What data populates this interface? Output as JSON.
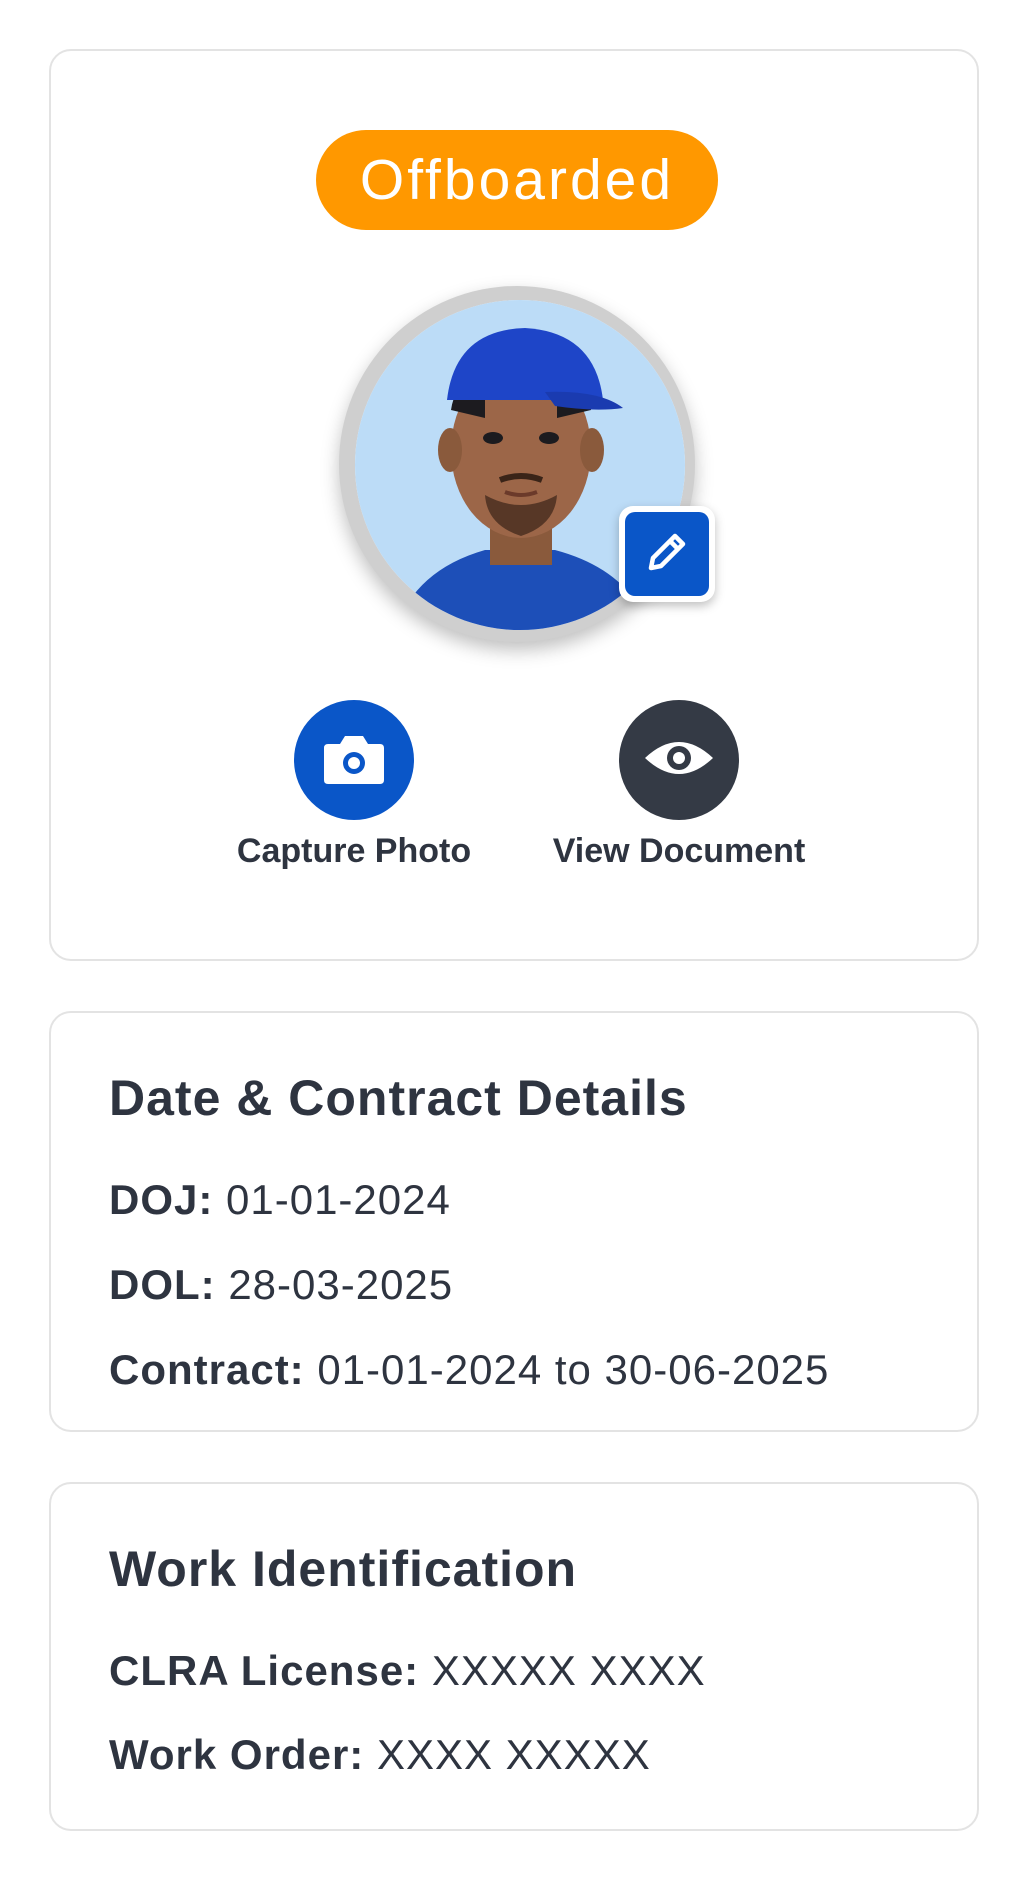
{
  "profile": {
    "status": "Offboarded",
    "status_color": "#ff9800",
    "avatar_icon": "worker-photo",
    "edit_icon": "pencil-icon",
    "actions": [
      {
        "label": "Capture Photo",
        "icon": "camera-icon",
        "color": "#0a56c8"
      },
      {
        "label": "View Document",
        "icon": "eye-icon",
        "color": "#343a45"
      }
    ]
  },
  "contract": {
    "title": "Date & Contract Details",
    "rows": [
      {
        "key": "DOJ:",
        "value": "01-01-2024"
      },
      {
        "key": "DOL:",
        "value": "28-03-2025"
      },
      {
        "key": "Contract:",
        "value": "01-01-2024 to 30-06-2025"
      }
    ]
  },
  "work": {
    "title": "Work Identification",
    "rows": [
      {
        "key": "CLRA License:",
        "value": "XXXXX XXXX"
      },
      {
        "key": "Work Order:",
        "value": "XXXX XXXXX"
      }
    ]
  }
}
